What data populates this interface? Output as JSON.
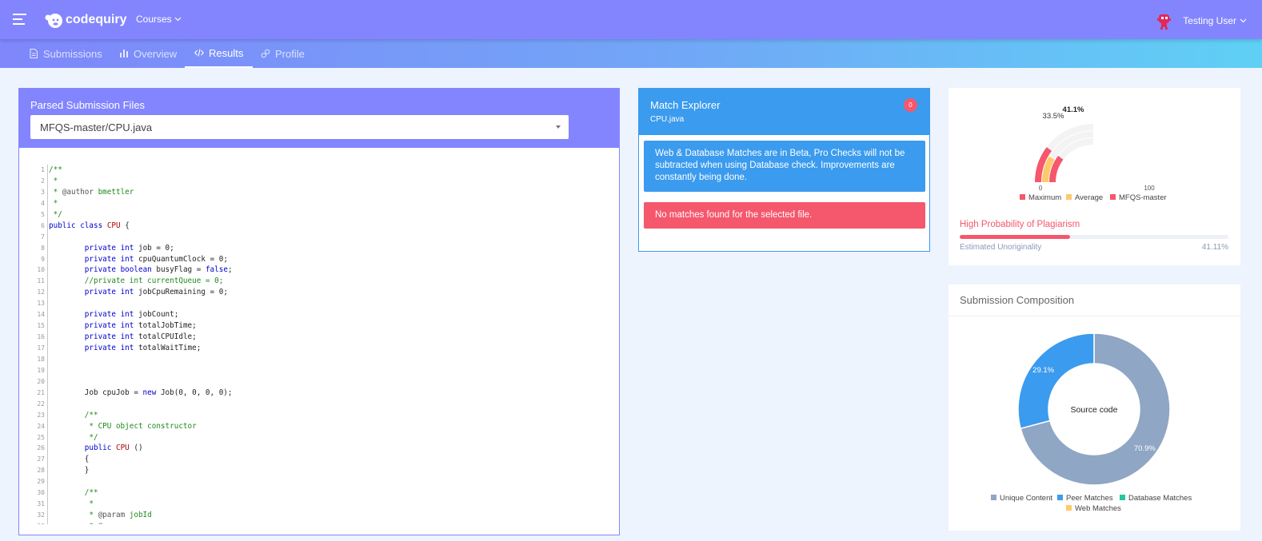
{
  "header": {
    "brand": "codequiry",
    "courses_label": "Courses",
    "user_name": "Testing User"
  },
  "tabs": [
    {
      "label": "Submissions",
      "icon": "file-icon"
    },
    {
      "label": "Overview",
      "icon": "bar-chart-icon"
    },
    {
      "label": "Results",
      "icon": "code-icon",
      "active": true
    },
    {
      "label": "Profile",
      "icon": "link-icon"
    }
  ],
  "parsed_files": {
    "title": "Parsed Submission Files",
    "selected_file": "MFQS-master/CPU.java",
    "code_lines": [
      [
        [
          "cmt",
          "/**"
        ]
      ],
      [
        [
          "cmt",
          " *"
        ]
      ],
      [
        [
          "cmt",
          " * "
        ],
        [
          "ann",
          "@author"
        ],
        [
          "cmt",
          " bmettler"
        ]
      ],
      [
        [
          "cmt",
          " *"
        ]
      ],
      [
        [
          "cmt",
          " */"
        ]
      ],
      [
        [
          "kw",
          "public"
        ],
        [
          "lc",
          " "
        ],
        [
          "kw",
          "class"
        ],
        [
          "lc",
          " "
        ],
        [
          "cls",
          "CPU"
        ],
        [
          "lc",
          " {"
        ]
      ],
      [
        [
          "lc",
          ""
        ]
      ],
      [
        [
          "lc",
          "        "
        ],
        [
          "kw",
          "private"
        ],
        [
          "lc",
          " "
        ],
        [
          "kw",
          "int"
        ],
        [
          "lc",
          " job = 0;"
        ]
      ],
      [
        [
          "lc",
          "        "
        ],
        [
          "kw",
          "private"
        ],
        [
          "lc",
          " "
        ],
        [
          "kw",
          "int"
        ],
        [
          "lc",
          " cpuQuantumClock = 0;"
        ]
      ],
      [
        [
          "lc",
          "        "
        ],
        [
          "kw",
          "private"
        ],
        [
          "lc",
          " "
        ],
        [
          "kw",
          "boolean"
        ],
        [
          "lc",
          " busyFlag = "
        ],
        [
          "kw",
          "false"
        ],
        [
          "lc",
          ";"
        ]
      ],
      [
        [
          "lc",
          "        "
        ],
        [
          "cmt",
          "//private int currentQueue = 0;"
        ]
      ],
      [
        [
          "lc",
          "        "
        ],
        [
          "kw",
          "private"
        ],
        [
          "lc",
          " "
        ],
        [
          "kw",
          "int"
        ],
        [
          "lc",
          " jobCpuRemaining = 0;"
        ]
      ],
      [
        [
          "lc",
          ""
        ]
      ],
      [
        [
          "lc",
          "        "
        ],
        [
          "kw",
          "private"
        ],
        [
          "lc",
          " "
        ],
        [
          "kw",
          "int"
        ],
        [
          "lc",
          " jobCount;"
        ]
      ],
      [
        [
          "lc",
          "        "
        ],
        [
          "kw",
          "private"
        ],
        [
          "lc",
          " "
        ],
        [
          "kw",
          "int"
        ],
        [
          "lc",
          " totalJobTime;"
        ]
      ],
      [
        [
          "lc",
          "        "
        ],
        [
          "kw",
          "private"
        ],
        [
          "lc",
          " "
        ],
        [
          "kw",
          "int"
        ],
        [
          "lc",
          " totalCPUIdle;"
        ]
      ],
      [
        [
          "lc",
          "        "
        ],
        [
          "kw",
          "private"
        ],
        [
          "lc",
          " "
        ],
        [
          "kw",
          "int"
        ],
        [
          "lc",
          " totalWaitTime;"
        ]
      ],
      [
        [
          "lc",
          ""
        ]
      ],
      [
        [
          "lc",
          ""
        ]
      ],
      [
        [
          "lc",
          ""
        ]
      ],
      [
        [
          "lc",
          "        Job cpuJob = "
        ],
        [
          "kw",
          "new"
        ],
        [
          "lc",
          " Job(0, 0, 0, 0);"
        ]
      ],
      [
        [
          "lc",
          ""
        ]
      ],
      [
        [
          "lc",
          "        "
        ],
        [
          "cmt",
          "/**"
        ]
      ],
      [
        [
          "lc",
          "        "
        ],
        [
          "cmt",
          " * CPU object constructor"
        ]
      ],
      [
        [
          "lc",
          "        "
        ],
        [
          "cmt",
          " */"
        ]
      ],
      [
        [
          "lc",
          "        "
        ],
        [
          "kw",
          "public"
        ],
        [
          "lc",
          " "
        ],
        [
          "cls",
          "CPU"
        ],
        [
          "lc",
          " ()"
        ]
      ],
      [
        [
          "lc",
          "        {"
        ]
      ],
      [
        [
          "lc",
          "        }"
        ]
      ],
      [
        [
          "lc",
          ""
        ]
      ],
      [
        [
          "lc",
          "        "
        ],
        [
          "cmt",
          "/**"
        ]
      ],
      [
        [
          "lc",
          "        "
        ],
        [
          "cmt",
          " *"
        ]
      ],
      [
        [
          "lc",
          "        "
        ],
        [
          "cmt",
          " * "
        ],
        [
          "ann",
          "@param"
        ],
        [
          "cmt",
          " jobId"
        ]
      ],
      [
        [
          "lc",
          "        "
        ],
        [
          "cmt",
          " * @"
        ]
      ]
    ]
  },
  "match_explorer": {
    "title": "Match Explorer",
    "file": "CPU.java",
    "badge": "0",
    "info": "Web & Database Matches are in Beta, Pro Checks will not be subtracted when using Database check. Improvements are constantly being done.",
    "warning": "No matches found for the selected file."
  },
  "gauge": {
    "probability_label": "High Probability of Plagiarism",
    "estimated_label": "Estimated Unoriginality",
    "estimated_value": "41.11%",
    "unoriginality_fraction": 0.4111,
    "chart_data": {
      "type": "radial-bar",
      "series": [
        {
          "name": "Maximum",
          "value": 41.1,
          "color": "#f5576c"
        },
        {
          "name": "Average",
          "value": 33.5,
          "color": "#ffc96a"
        },
        {
          "name": "MFQS-master",
          "value": 41.1,
          "color": "#f5576c"
        }
      ],
      "value_labels": [
        "33.5%",
        "41.1%"
      ],
      "axis_min_label": "0",
      "axis_max_label": "100",
      "range": [
        0,
        100
      ]
    }
  },
  "composition": {
    "title": "Submission Composition",
    "center_label": "Source code",
    "chart_data": {
      "type": "pie",
      "categories": [
        "Unique Content",
        "Peer Matches",
        "Database Matches",
        "Web Matches"
      ],
      "values": [
        70.9,
        29.1,
        0,
        0
      ],
      "colors": [
        "#8fa6c4",
        "#3b9bee",
        "#26c6a1",
        "#ffc96a"
      ],
      "labels": [
        "70.9%",
        "29.1%"
      ]
    }
  },
  "colors": {
    "topbar": "#8385fe",
    "accent_blue": "#3b9bee",
    "danger": "#f5576c"
  }
}
